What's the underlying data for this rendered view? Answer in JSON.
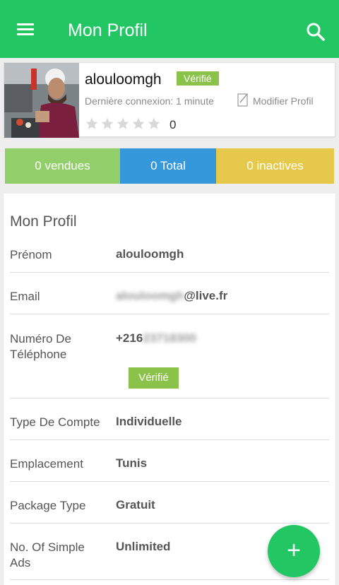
{
  "appbar": {
    "title": "Mon Profil",
    "menu_icon": "hamburger-menu-icon",
    "search_icon": "search-icon",
    "color": "#22c764"
  },
  "profile": {
    "username": "alouloomgh",
    "verified_label": "Vérifié",
    "last_login": "Dernière connexion: 1 minute",
    "edit_label": "Modifier Profil",
    "rating_stars": 0,
    "rating_max": 5,
    "rating_count": "0"
  },
  "stats": {
    "sold": "0 vendues",
    "total": "0 Total",
    "inactive": "0 inactives",
    "colors": {
      "sold": "#92cf6a",
      "total": "#3498db",
      "inactive": "#e6c94a"
    }
  },
  "details": {
    "title": "Mon Profil",
    "rows": [
      {
        "label": "Prénom",
        "value": "alouloomgh"
      },
      {
        "label": "Email",
        "value_blurred": "alouloomgh",
        "value_visible": "@live.fr"
      },
      {
        "label": "Numéro De Téléphone",
        "value_visible": "+216",
        "value_blurred": "23718300",
        "badge": "Vérifié"
      },
      {
        "label": "Type De Compte",
        "value": "Individuelle"
      },
      {
        "label": "Emplacement",
        "value": "Tunis"
      },
      {
        "label": "Package Type",
        "value": "Gratuit"
      },
      {
        "label": "No. Of Simple Ads",
        "value": "Unlimited"
      }
    ]
  },
  "fab": {
    "label": "+",
    "icon": "add-icon"
  }
}
